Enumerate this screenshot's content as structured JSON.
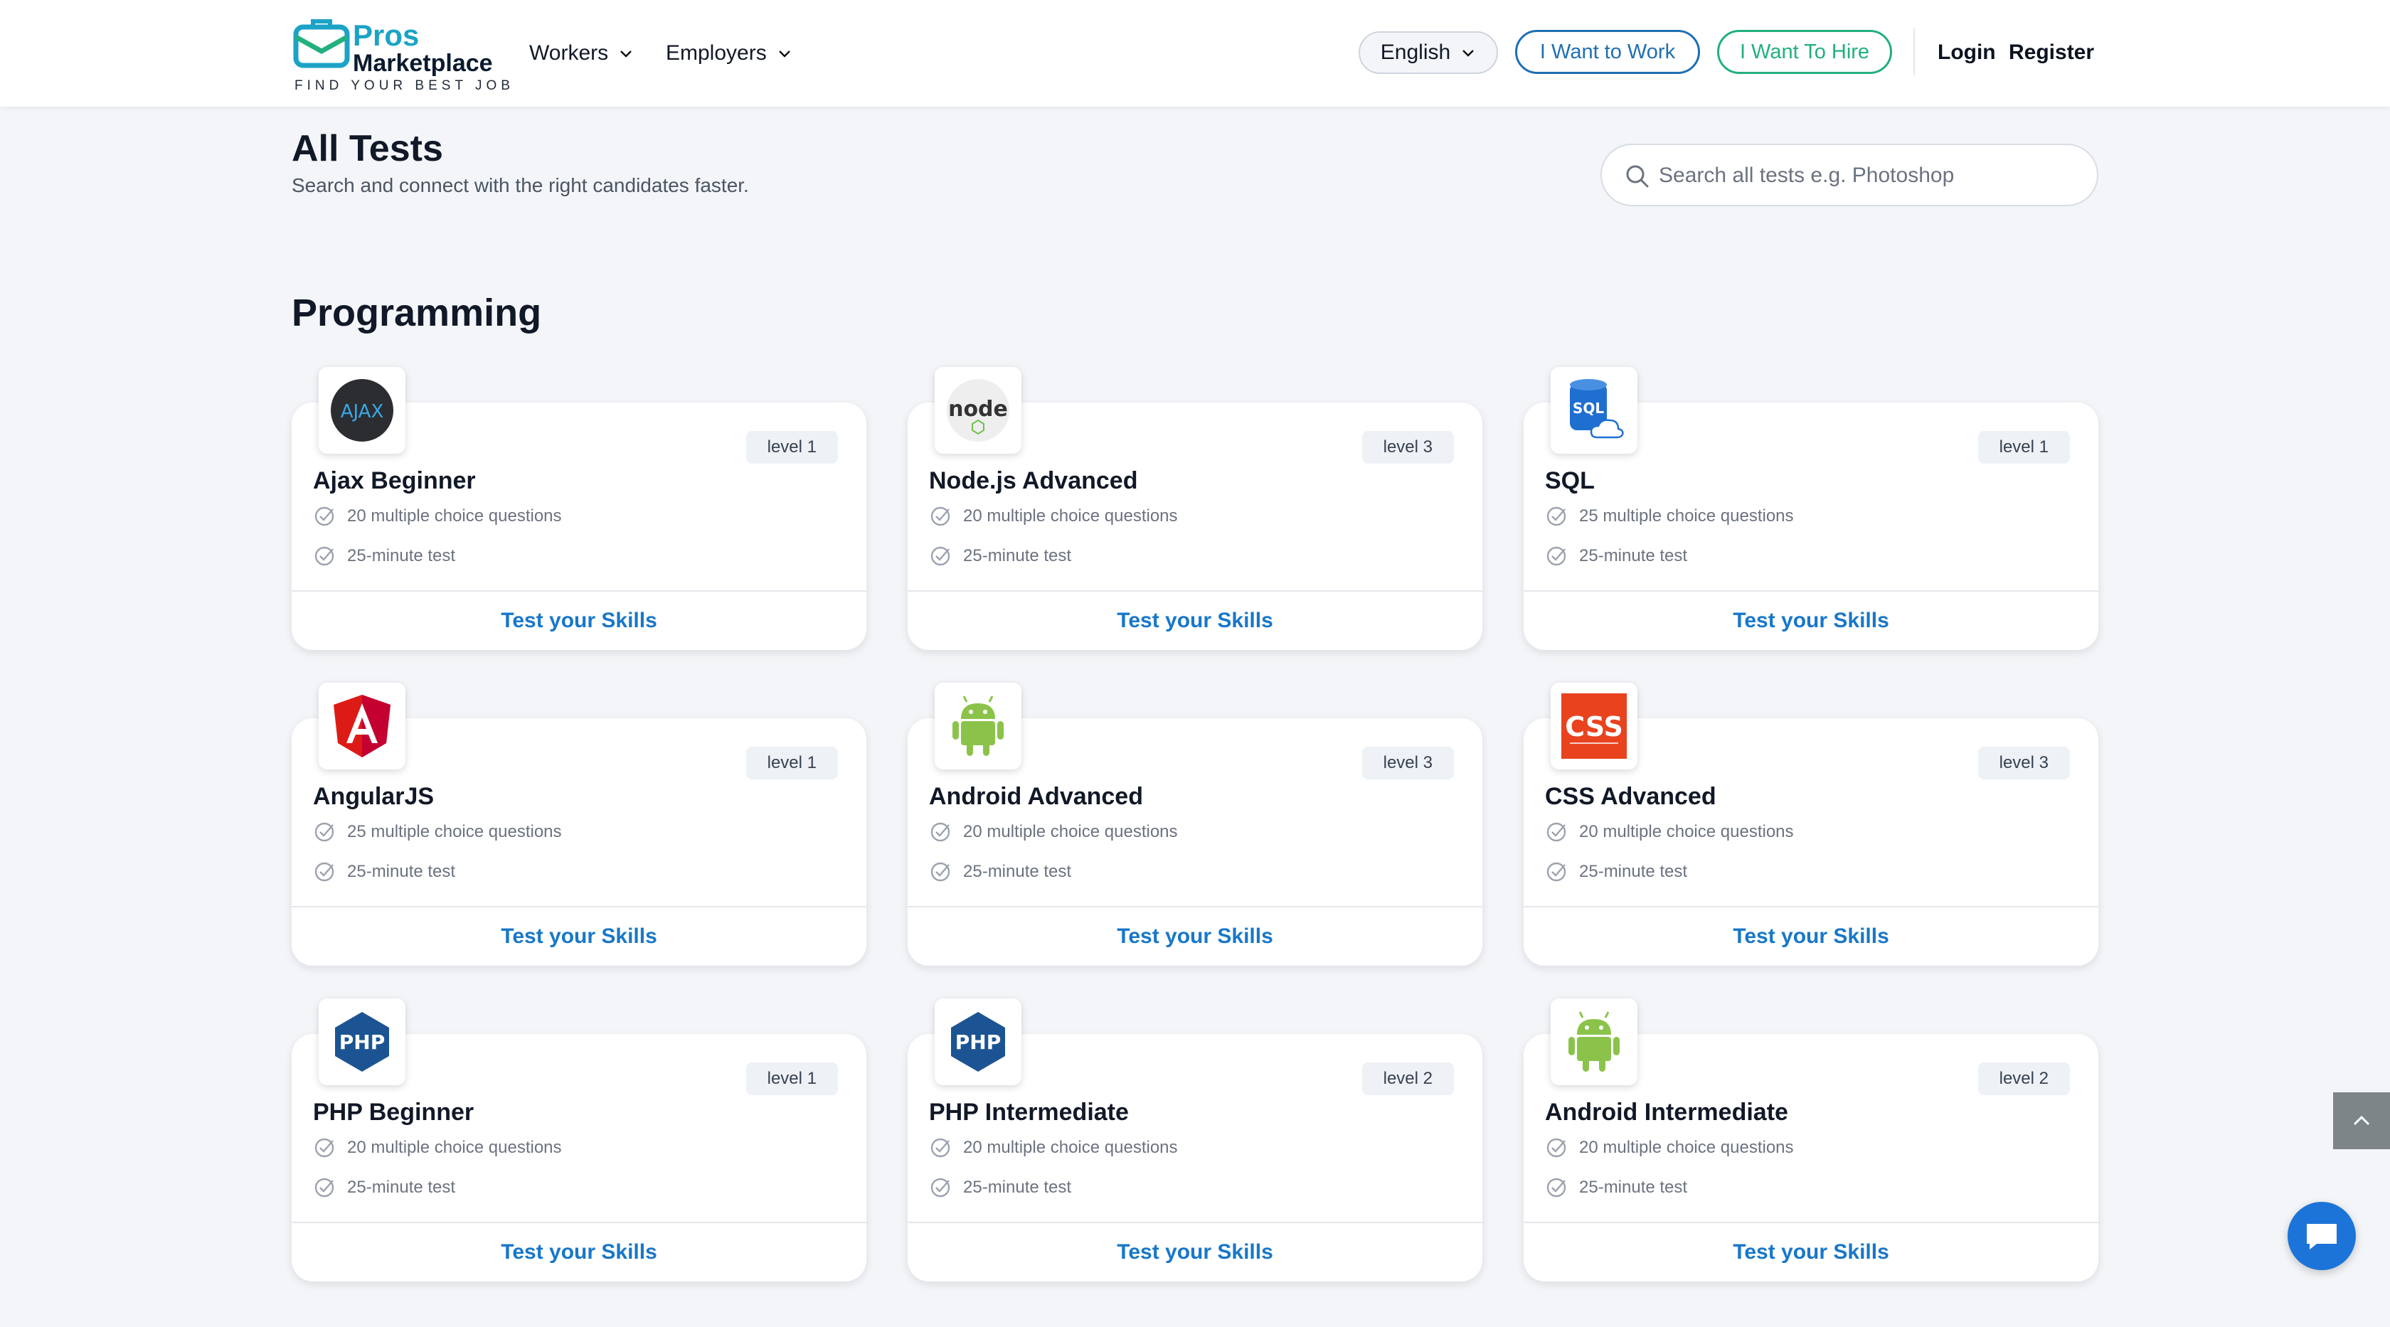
{
  "brand": {
    "name_top": "Pros",
    "name_bottom": "Marketplace",
    "tagline": "FIND YOUR BEST JOB",
    "accent": "#1ba3c6"
  },
  "nav": {
    "items": [
      {
        "label": "Workers"
      },
      {
        "label": "Employers"
      }
    ],
    "language": "English",
    "work_button": "I Want to Work",
    "hire_button": "I Want To Hire",
    "login": "Login",
    "register": "Register"
  },
  "page": {
    "title": "All Tests",
    "subtitle": "Search and connect with the right candidates faster.",
    "search_placeholder": "Search all tests e.g. Photoshop"
  },
  "section": {
    "title": "Programming",
    "cards": [
      {
        "title": "Ajax Beginner",
        "level": "level 1",
        "questions": "20 multiple choice questions",
        "duration": "25-minute test",
        "action": "Test your Skills",
        "icon": "ajax-icon"
      },
      {
        "title": "Node.js Advanced",
        "level": "level 3",
        "questions": "20 multiple choice questions",
        "duration": "25-minute test",
        "action": "Test your Skills",
        "icon": "nodejs-icon"
      },
      {
        "title": "SQL",
        "level": "level 1",
        "questions": "25 multiple choice questions",
        "duration": "25-minute test",
        "action": "Test your Skills",
        "icon": "sql-icon"
      },
      {
        "title": "AngularJS",
        "level": "level 1",
        "questions": "25 multiple choice questions",
        "duration": "25-minute test",
        "action": "Test your Skills",
        "icon": "angular-icon"
      },
      {
        "title": "Android Advanced",
        "level": "level 3",
        "questions": "20 multiple choice questions",
        "duration": "25-minute test",
        "action": "Test your Skills",
        "icon": "android-icon"
      },
      {
        "title": "CSS Advanced",
        "level": "level 3",
        "questions": "20 multiple choice questions",
        "duration": "25-minute test",
        "action": "Test your Skills",
        "icon": "css-icon"
      },
      {
        "title": "PHP Beginner",
        "level": "level 1",
        "questions": "20 multiple choice questions",
        "duration": "25-minute test",
        "action": "Test your Skills",
        "icon": "php-icon"
      },
      {
        "title": "PHP Intermediate",
        "level": "level 2",
        "questions": "20 multiple choice questions",
        "duration": "25-minute test",
        "action": "Test your Skills",
        "icon": "php-icon"
      },
      {
        "title": "Android Intermediate",
        "level": "level 2",
        "questions": "20 multiple choice questions",
        "duration": "25-minute test",
        "action": "Test your Skills",
        "icon": "android-icon"
      }
    ]
  },
  "icon_text": {
    "ajax": "AJAX",
    "node": "node",
    "sql": "SQL",
    "css": "CSS",
    "php": "PHP"
  }
}
